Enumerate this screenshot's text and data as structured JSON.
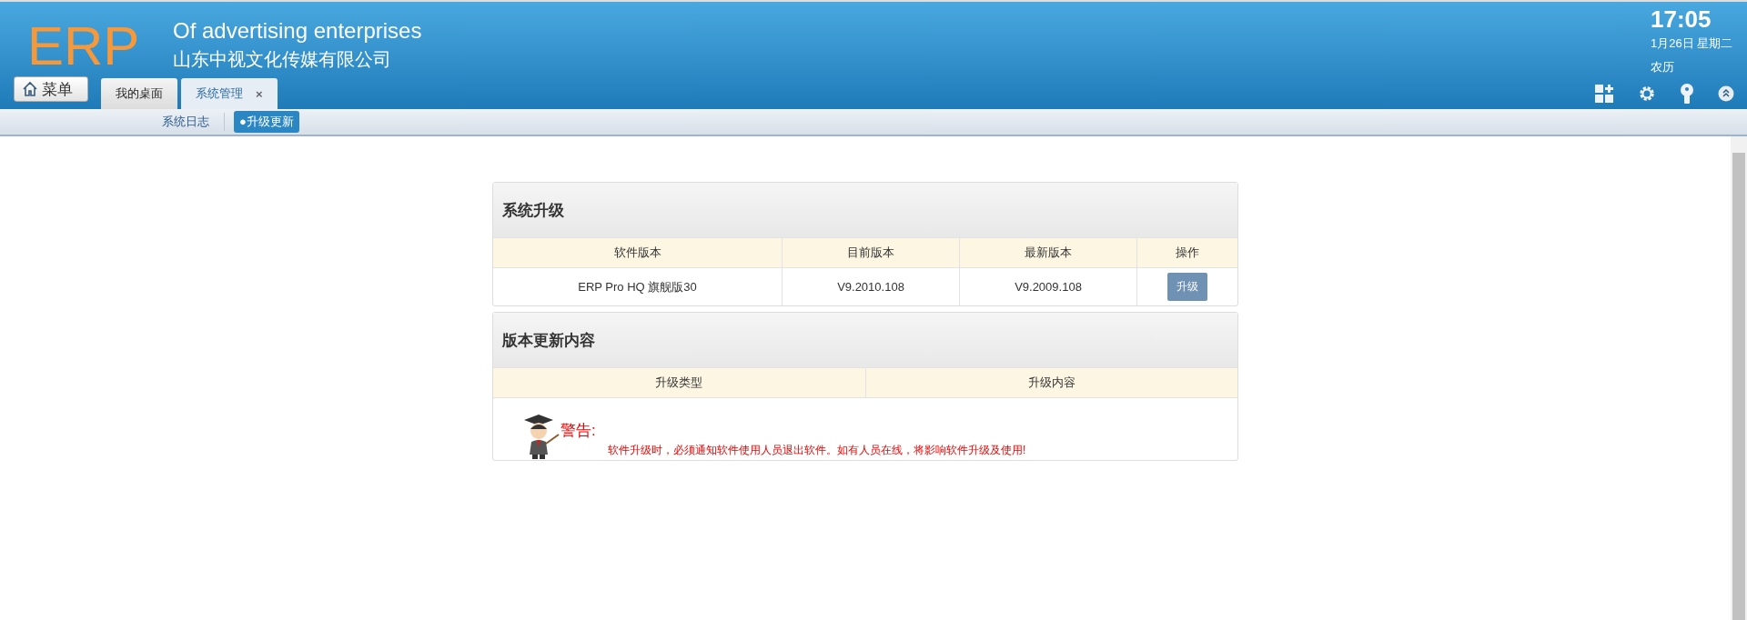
{
  "header": {
    "logo": "ERP",
    "slogan": "Of advertising enterprises",
    "company": "山东中视文化传媒有限公司",
    "menu_button": "菜单",
    "clock": {
      "time": "17:05",
      "date": "1月26日 星期二",
      "lunar": "农历"
    }
  },
  "tabs": [
    {
      "label": "我的桌面",
      "selected": false
    },
    {
      "label": "系统管理",
      "selected": true,
      "close": "×"
    }
  ],
  "subnav": [
    {
      "label": "系统日志",
      "selected": false
    },
    {
      "label": "●升级更新",
      "selected": true
    }
  ],
  "upgrade_panel": {
    "title": "系统升级",
    "columns": [
      "软件版本",
      "目前版本",
      "最新版本",
      "操作"
    ],
    "rows": [
      {
        "software": "ERP Pro HQ 旗舰版30",
        "current": "V9.2010.108",
        "latest": "V9.2009.108",
        "action": "升级"
      }
    ]
  },
  "changes_panel": {
    "title": "版本更新内容",
    "columns": [
      "升级类型",
      "升级内容"
    ],
    "warning": {
      "label": "警告:",
      "message": "软件升级时，必须通知软件使用人员退出软件。如有人员在线，将影响软件升级及使用!"
    }
  }
}
